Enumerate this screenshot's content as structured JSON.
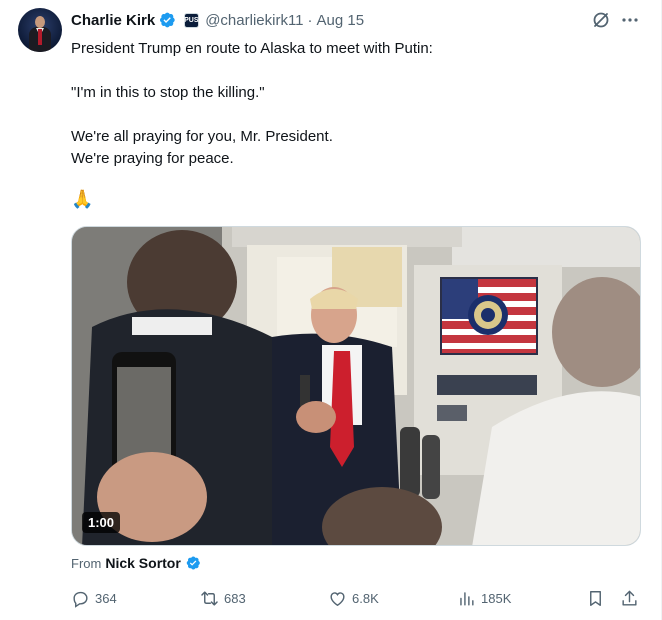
{
  "author": {
    "name": "Charlie Kirk",
    "handle": "@charliekirk11",
    "separator": "·",
    "date": "Aug 15",
    "affiliate_badge": "TPUSA"
  },
  "tweet": {
    "line1": "President Trump en route to Alaska to meet with Putin:",
    "line2": "\"I'm in this to stop the killing.\"",
    "line3": "We're all praying for you, Mr. President.",
    "line4": "We're praying for peace.",
    "emoji": "🙏"
  },
  "media": {
    "duration": "1:00"
  },
  "source": {
    "prefix": "From",
    "name": "Nick Sortor"
  },
  "actions": {
    "replies": "364",
    "reposts": "683",
    "likes": "6.8K",
    "views": "185K"
  },
  "colors": {
    "text": "#0f1419",
    "secondary": "#536471",
    "verified": "#1d9bf0",
    "border": "#cfd9de"
  },
  "icons": [
    "verified-badge-icon",
    "affiliate-badge-icon",
    "grok-icon",
    "more-icon",
    "reply-icon",
    "repost-icon",
    "like-icon",
    "views-icon",
    "bookmark-icon",
    "share-icon"
  ]
}
